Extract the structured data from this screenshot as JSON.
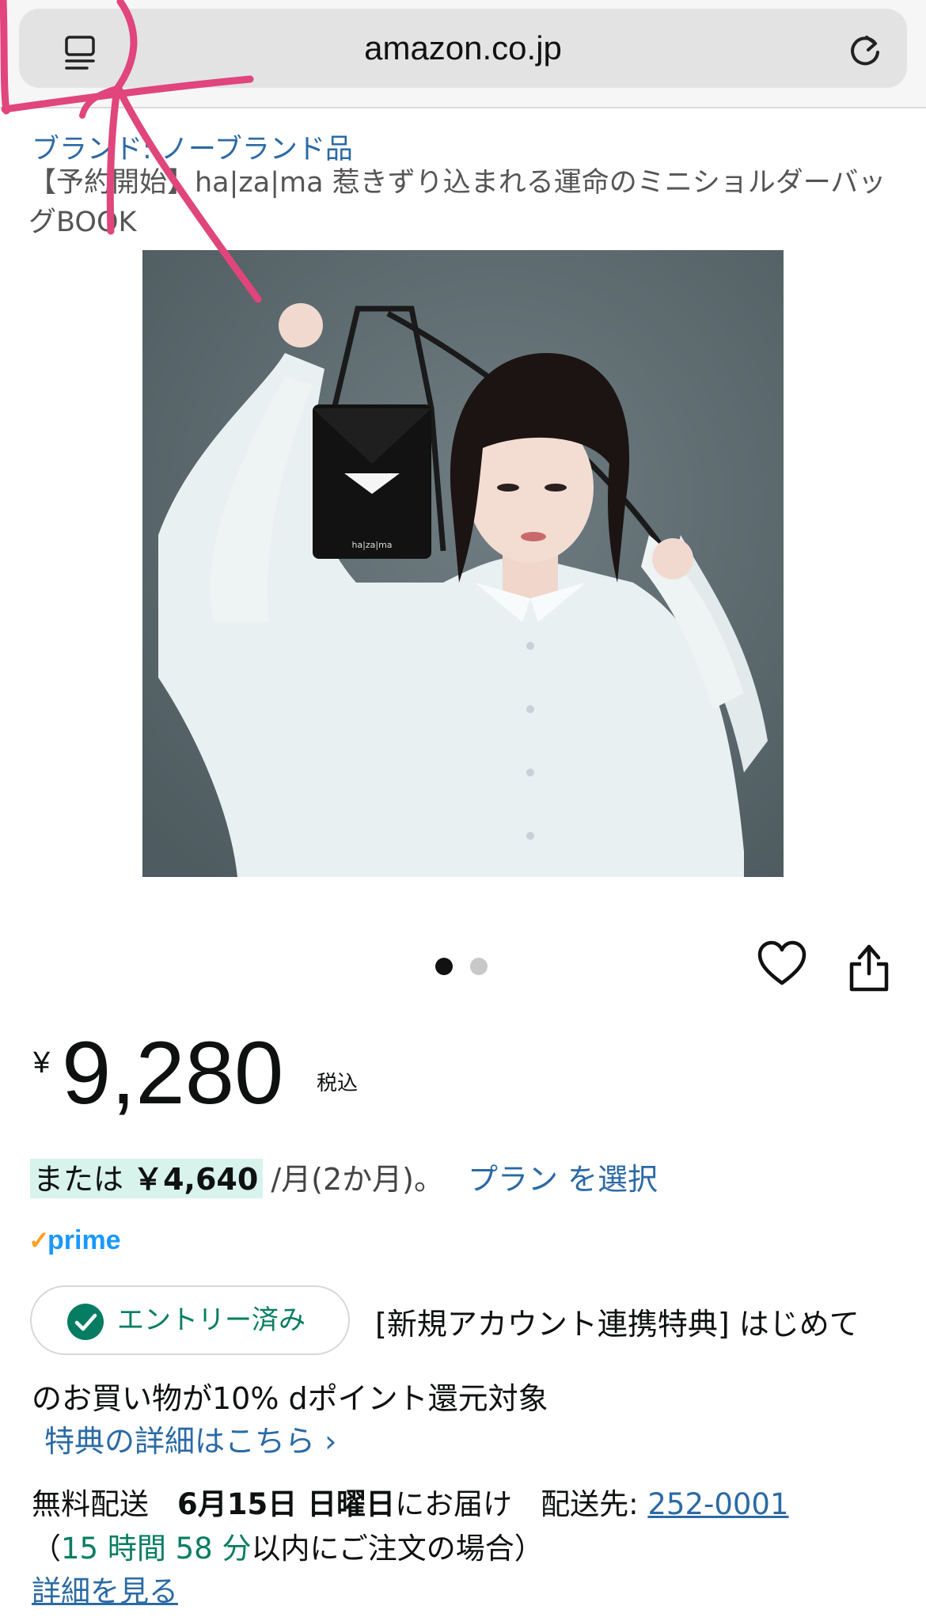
{
  "browser": {
    "url": "amazon.co.jp",
    "tabs_icon": "tab-overview-icon",
    "reload_icon": "reload-icon"
  },
  "product": {
    "brand": "ブランド: ノーブランド品",
    "title": "【予約開始】ha|za|ma 惹きずり込まれる運命のミニショルダーバッグBOOK",
    "image_caption": "ha|za|ma",
    "carousel": {
      "count": 2,
      "active": 1
    }
  },
  "price": {
    "currency": "¥",
    "amount": "9,280",
    "tax_label": "税込"
  },
  "installment": {
    "prefix": "または",
    "amount": "￥4,640",
    "suffix": "/月(2か月)。",
    "plan_link": "プラン を選択"
  },
  "prime": {
    "logo_text": "prime",
    "check_mark": "✓"
  },
  "promotion": {
    "entry_label": "エントリー済み",
    "text_line1": "[新規アカウント連携特典] はじめて",
    "text_line2": "のお買い物が10% dポイント還元対象",
    "details_link": "特典の詳細はこちら ›"
  },
  "delivery": {
    "free_label": "無料配送",
    "date": "6月15日 日曜日",
    "date_suffix": "にお届け",
    "ship_to_label": "配送先:",
    "postal_code": "252-0001",
    "order_prefix": "（",
    "countdown": "15 時間 58 分",
    "order_suffix": "以内にご注文の場合）",
    "details_link": "詳細を見る"
  },
  "colors": {
    "link": "#2b6aa5",
    "green": "#067d62",
    "highlight_bg": "#d7f3ec",
    "annotation": "#e0457b",
    "prime_blue": "#1a98ff",
    "prime_orange": "#f7a21b"
  }
}
